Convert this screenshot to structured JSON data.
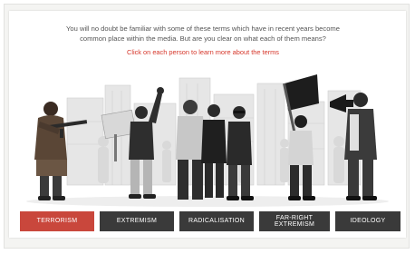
{
  "intro": {
    "line1": "You will no doubt be familiar with some of these terms which have in recent years become",
    "line2": "common place within the media. But are you clear on what each of them means?",
    "cta": "Click on each person to learn more about the terms"
  },
  "tabs": [
    {
      "label": "TERRORISM",
      "active": true
    },
    {
      "label": "EXTREMISM",
      "active": false
    },
    {
      "label": "RADICALISATION",
      "active": false
    },
    {
      "label_line1": "FAR-RIGHT",
      "label_line2": "EXTREMISM",
      "active": false
    },
    {
      "label": "IDEOLOGY",
      "active": false
    }
  ],
  "colors": {
    "accent_red": "#c9473c",
    "cta_red": "#d6372b",
    "tab_dark": "#3a3a3a"
  }
}
